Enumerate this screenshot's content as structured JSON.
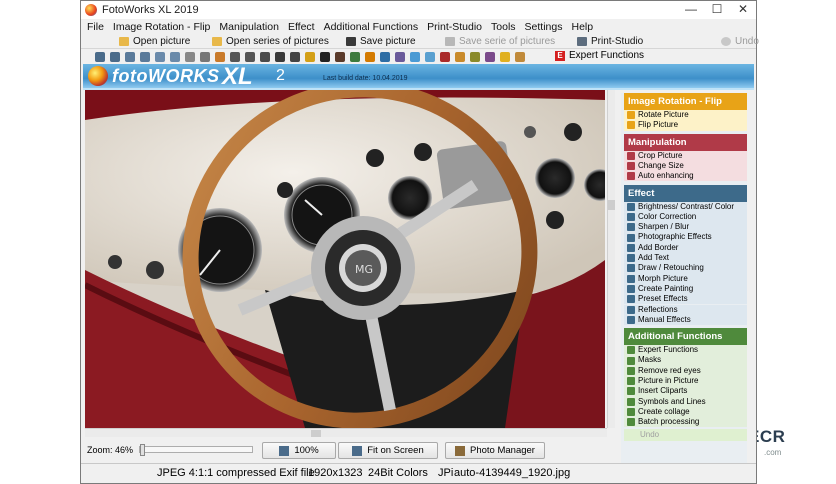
{
  "window": {
    "title": "FotoWorks XL 2019"
  },
  "window_controls": [
    "—",
    "☐",
    "✕"
  ],
  "menu": [
    "File",
    "Image Rotation - Flip",
    "Manipulation",
    "Effect",
    "Additional Functions",
    "Print-Studio",
    "Tools",
    "Settings",
    "Help"
  ],
  "toolbar": {
    "open_picture": "Open picture",
    "open_series": "Open series of pictures",
    "save_picture": "Save picture",
    "save_series": "Save serie of pictures",
    "print_studio": "Print-Studio",
    "undo": "Undo",
    "expert_functions": "Expert Functions",
    "expert_badge": "E"
  },
  "banner": {
    "logo_text": "fotoWORKS",
    "logo_xl": "XL",
    "logo_num": "2",
    "build_date": "Last build date: 10.04.2019"
  },
  "bottom": {
    "zoom_label": "Zoom: 46%",
    "zoom_value": 46,
    "btn_100": "100%",
    "btn_fit": "Fit on Screen",
    "btn_manager": "Photo Manager"
  },
  "status": {
    "format": "JPEG 4:1:1 compressed Exif file",
    "size": "1920x1323",
    "colors": "24Bit Colors",
    "type": "JPi",
    "filename": "auto-4139449_1920.jpg"
  },
  "panel": {
    "sections": [
      {
        "title": "Image Rotation - Flip",
        "color": "#e8a317",
        "items": [
          {
            "label": "Rotate Picture",
            "icon": "rotate-icon"
          },
          {
            "label": "Flip Picture",
            "icon": "flip-icon"
          }
        ]
      },
      {
        "title": "Manipulation",
        "color": "#b03a48",
        "items": [
          {
            "label": "Crop Picture",
            "icon": "crop-icon"
          },
          {
            "label": "Change Size",
            "icon": "resize-icon"
          },
          {
            "label": "Auto enhancing",
            "icon": "wand-icon"
          }
        ]
      },
      {
        "title": "Effect",
        "color": "#3d6a8a",
        "items": [
          {
            "label": "Brightness/ Contrast/ Color",
            "icon": "brightness-icon"
          },
          {
            "label": "Color Correction",
            "icon": "color-icon"
          },
          {
            "label": "Sharpen / Blur",
            "icon": "sharpen-icon"
          },
          {
            "label": "Photographic Effects",
            "icon": "photo-effects-icon"
          },
          {
            "label": "Add Border",
            "icon": "border-icon"
          },
          {
            "label": "Add Text",
            "icon": "text-icon"
          },
          {
            "label": "Draw / Retouching",
            "icon": "draw-icon"
          },
          {
            "label": "Morph Picture",
            "icon": "morph-icon"
          },
          {
            "label": "Create Painting",
            "icon": "painting-icon"
          },
          {
            "label": "Preset Effects",
            "icon": "preset-icon"
          },
          {
            "label": "Reflections",
            "icon": "reflection-icon"
          },
          {
            "label": "Manual Effects",
            "icon": "manual-icon"
          }
        ]
      },
      {
        "title": "Additional Functions",
        "color": "#4f8a3c",
        "items": [
          {
            "label": "Expert Functions",
            "icon": "expert-icon"
          },
          {
            "label": "Masks",
            "icon": "mask-icon"
          },
          {
            "label": "Remove red eyes",
            "icon": "red-eye-icon"
          },
          {
            "label": "Picture in Picture",
            "icon": "pip-icon"
          },
          {
            "label": "Insert Cliparts",
            "icon": "clipart-icon"
          },
          {
            "label": "Symbols and Lines",
            "icon": "symbols-icon"
          },
          {
            "label": "Create collage",
            "icon": "collage-icon"
          },
          {
            "label": "Batch processing",
            "icon": "batch-icon"
          }
        ]
      }
    ],
    "undo": "Undo"
  },
  "watermark": {
    "brand": "FILECR",
    "sub": ".com"
  }
}
